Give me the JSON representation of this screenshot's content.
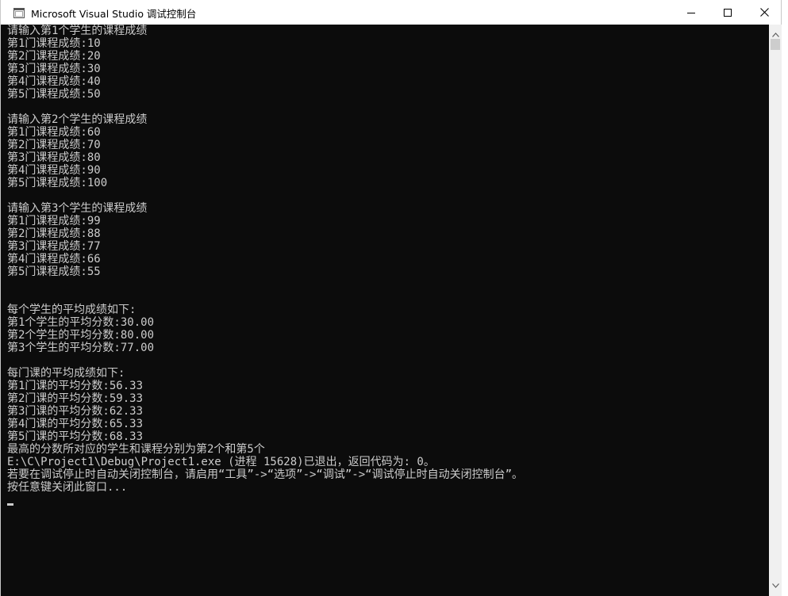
{
  "window": {
    "title": "Microsoft Visual Studio 调试控制台"
  },
  "icons": {
    "app": "console-app-icon",
    "minimize": "minimize-icon",
    "maximize": "maximize-icon",
    "close": "close-icon",
    "scroll_up": "scroll-up-arrow-icon",
    "scroll_down": "scroll-down-arrow-icon"
  },
  "colors": {
    "console_bg": "#0c0c0c",
    "console_fg": "#cccccc",
    "titlebar_bg": "#ffffff"
  },
  "console": {
    "lines": [
      "请输入第1个学生的课程成绩",
      "第1门课程成绩:10",
      "第2门课程成绩:20",
      "第3门课程成绩:30",
      "第4门课程成绩:40",
      "第5门课程成绩:50",
      "",
      "请输入第2个学生的课程成绩",
      "第1门课程成绩:60",
      "第2门课程成绩:70",
      "第3门课程成绩:80",
      "第4门课程成绩:90",
      "第5门课程成绩:100",
      "",
      "请输入第3个学生的课程成绩",
      "第1门课程成绩:99",
      "第2门课程成绩:88",
      "第3门课程成绩:77",
      "第4门课程成绩:66",
      "第5门课程成绩:55",
      "",
      "",
      "每个学生的平均成绩如下:",
      "第1个学生的平均分数:30.00",
      "第2个学生的平均分数:80.00",
      "第3个学生的平均分数:77.00",
      "",
      "每门课的平均成绩如下:",
      "第1门课的平均分数:56.33",
      "第2门课的平均分数:59.33",
      "第3门课的平均分数:62.33",
      "第4门课的平均分数:65.33",
      "第5门课的平均分数:68.33",
      "最高的分数所对应的学生和课程分别为第2个和第5个",
      "E:\\C\\Project1\\Debug\\Project1.exe (进程 15628)已退出，返回代码为: 0。",
      "若要在调试停止时自动关闭控制台，请启用“工具”->“选项”->“调试”->“调试停止时自动关闭控制台”。",
      "按任意键关闭此窗口..."
    ]
  }
}
